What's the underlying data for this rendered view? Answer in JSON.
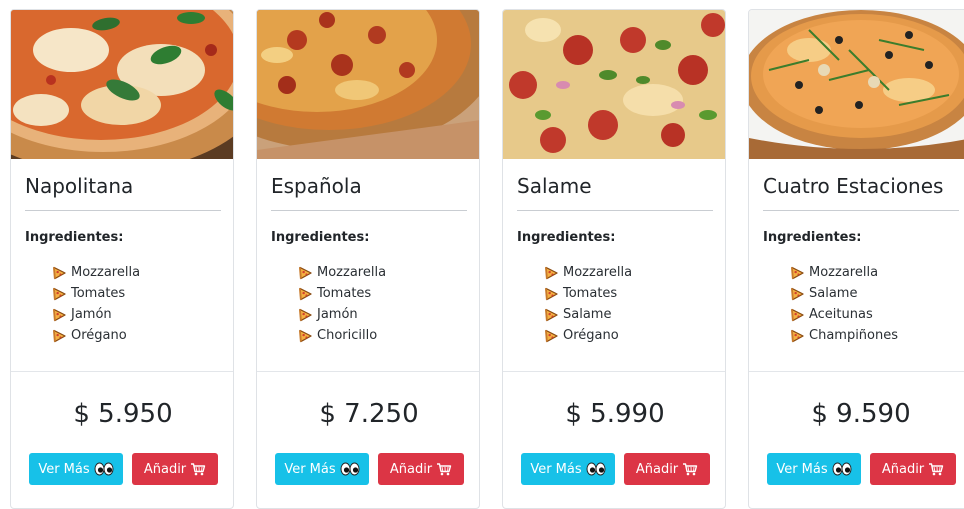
{
  "cards": [
    {
      "title": "Napolitana",
      "ingredients_label": "Ingredientes:",
      "ingredients": [
        "Mozzarella",
        "Tomates",
        "Jamón",
        "Orégano"
      ],
      "price": "$ 5.950",
      "details_button": "Ver Más",
      "add_button": "Añadir",
      "image": "pizza-napolitana-photo"
    },
    {
      "title": "Española",
      "ingredients_label": "Ingredientes:",
      "ingredients": [
        "Mozzarella",
        "Tomates",
        "Jamón",
        "Choricillo"
      ],
      "price": "$ 7.250",
      "details_button": "Ver Más",
      "add_button": "Añadir",
      "image": "pizza-espanola-photo"
    },
    {
      "title": "Salame",
      "ingredients_label": "Ingredientes:",
      "ingredients": [
        "Mozzarella",
        "Tomates",
        "Salame",
        "Orégano"
      ],
      "price": "$ 5.990",
      "details_button": "Ver Más",
      "add_button": "Añadir",
      "image": "pizza-salame-photo"
    },
    {
      "title": "Cuatro Estaciones",
      "ingredients_label": "Ingredientes:",
      "ingredients": [
        "Mozzarella",
        "Salame",
        "Aceitunas",
        "Champiñones"
      ],
      "price": "$ 9.590",
      "details_button": "Ver Más",
      "add_button": "Añadir",
      "image": "pizza-cuatro-estaciones-photo"
    }
  ],
  "icons": {
    "ingredient_bullet": "pizza-slice-icon",
    "details": "eyes-icon",
    "add": "shopping-cart-icon"
  },
  "colors": {
    "details_button": "#17c1e8",
    "add_button": "#dc3545"
  }
}
